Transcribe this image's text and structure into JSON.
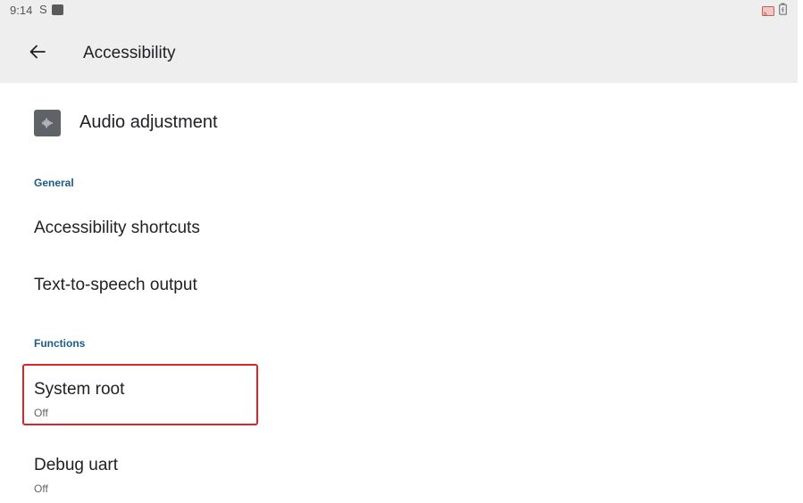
{
  "status_bar": {
    "time": "9:14",
    "s_icon": "S",
    "icons": [
      "notification-square-icon",
      "cast-icon",
      "battery-icon"
    ]
  },
  "toolbar": {
    "back_icon": "arrow-left-icon",
    "title": "Accessibility"
  },
  "items": {
    "audio": {
      "label": "Audio adjustment",
      "icon": "audio-wave-icon"
    },
    "general_header": "General",
    "accessibility_shortcuts": "Accessibility shortcuts",
    "tts_output": "Text-to-speech output",
    "functions_header": "Functions",
    "system_root": {
      "title": "System root",
      "summary": "Off"
    },
    "debug_uart": {
      "title": "Debug uart",
      "summary": "Off"
    }
  },
  "colors": {
    "appbar_bg": "#eeeeee",
    "section_header": "#1a5b8c",
    "highlight": "#d9262c"
  }
}
